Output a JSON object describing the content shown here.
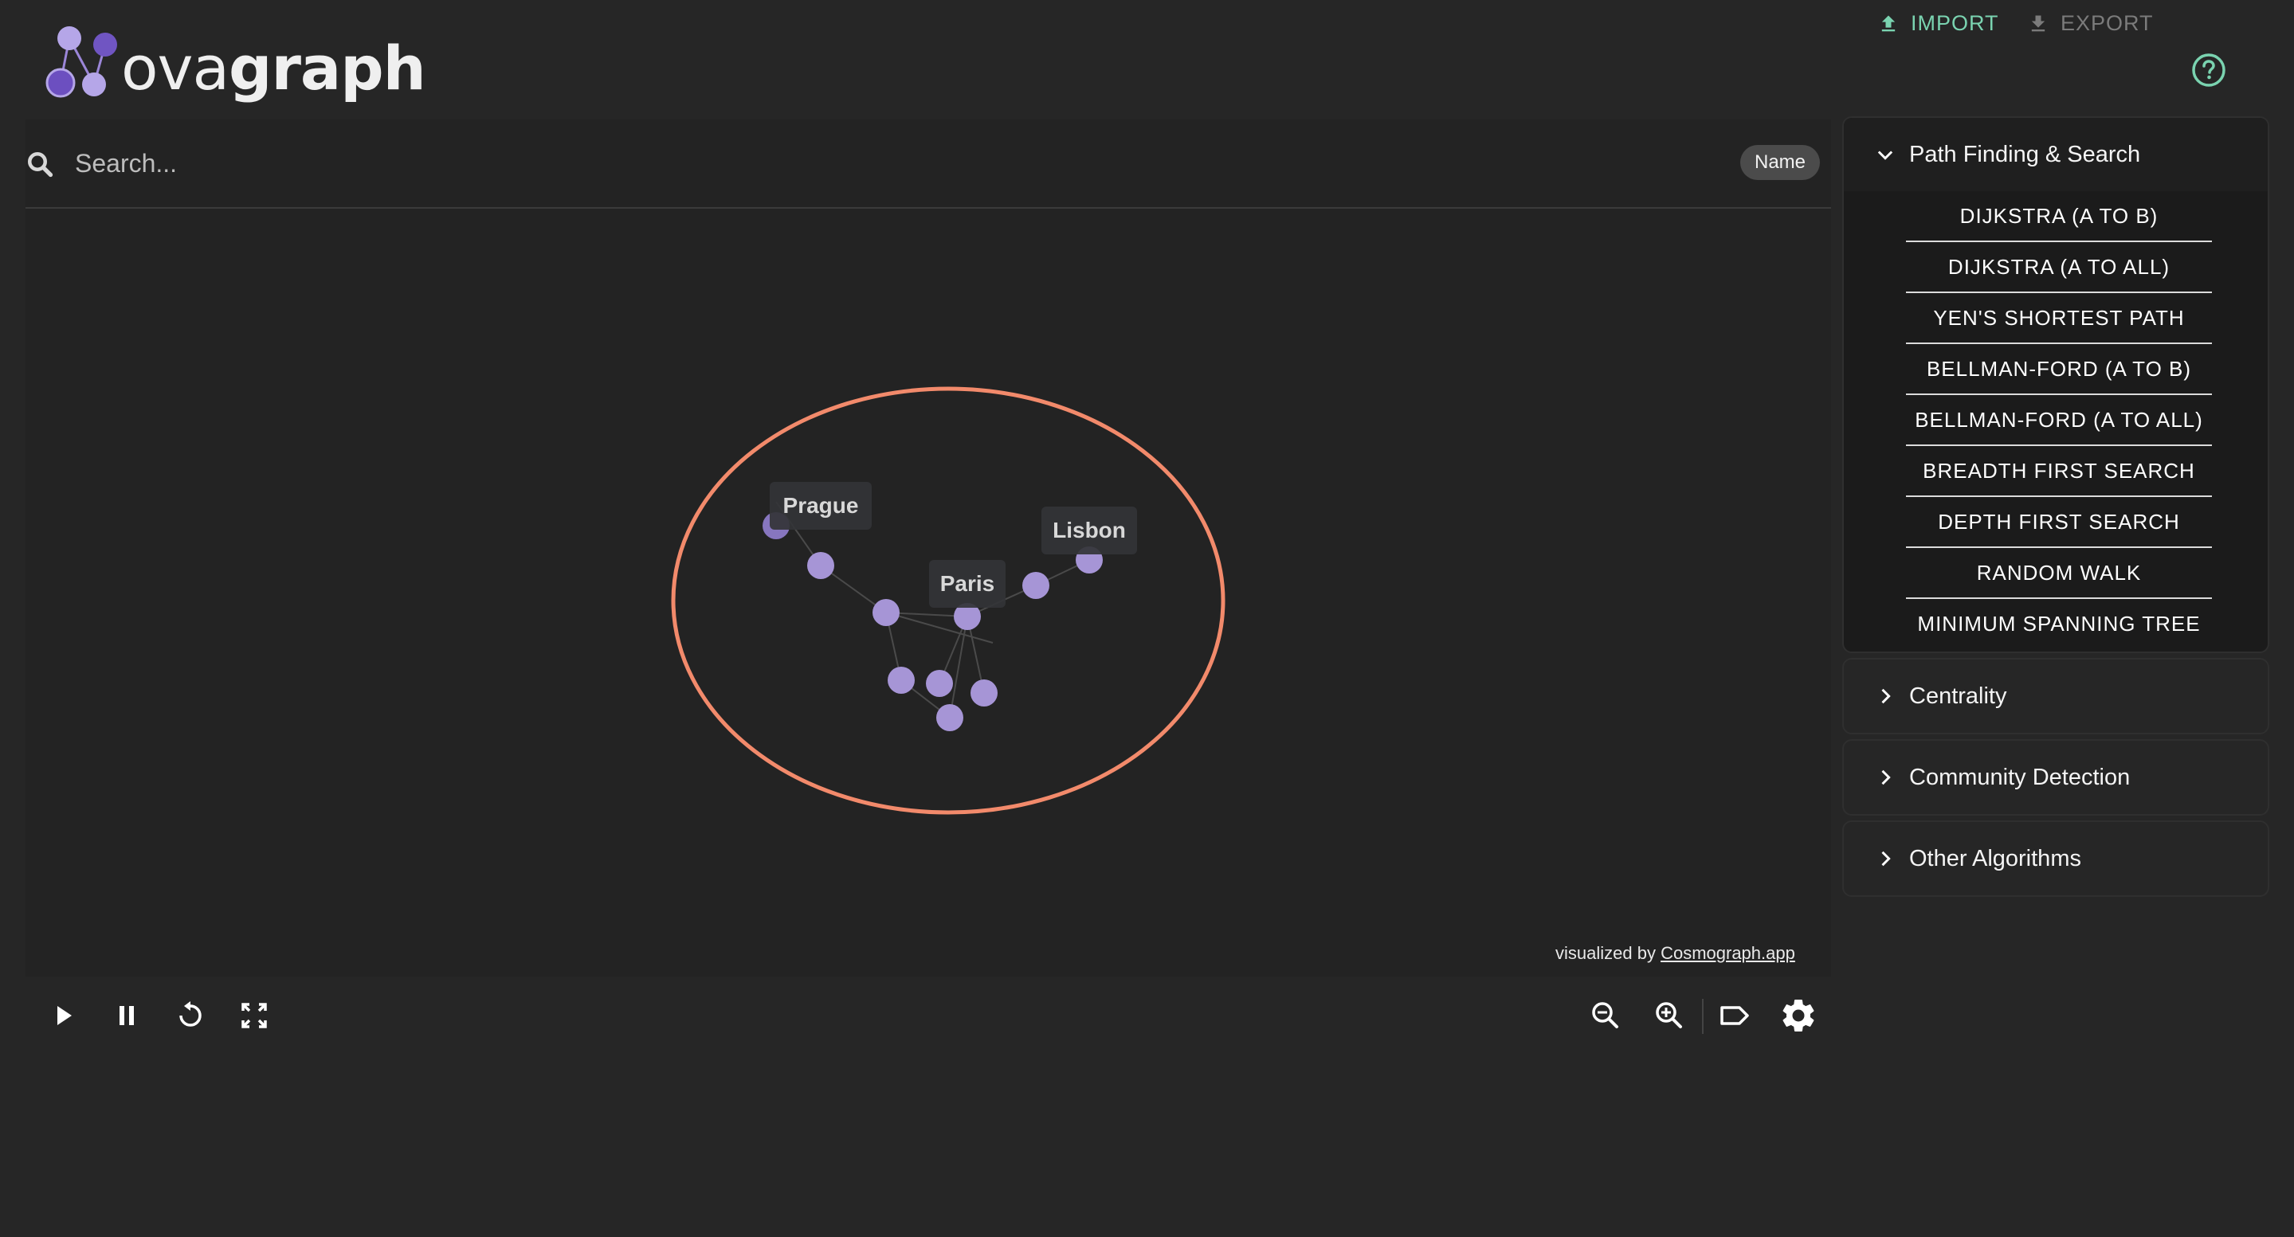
{
  "app": {
    "logo_plain": "ova",
    "logo_bold": "graph"
  },
  "header": {
    "import_label": "IMPORT",
    "export_label": "EXPORT"
  },
  "search": {
    "placeholder": "Search...",
    "field_chip": "Name"
  },
  "graph": {
    "labels": [
      "Prague",
      "Paris",
      "Lisbon"
    ],
    "node_color": "#a695d6",
    "highlight_color": "#f28a6b"
  },
  "credit": {
    "prefix": "visualized by ",
    "link": "Cosmograph.app"
  },
  "panel": {
    "sections": [
      {
        "title": "Path Finding & Search",
        "expanded": true,
        "items": [
          "DIJKSTRA (A TO B)",
          "DIJKSTRA (A TO ALL)",
          "YEN'S SHORTEST PATH",
          "BELLMAN-FORD (A TO B)",
          "BELLMAN-FORD (A TO ALL)",
          "BREADTH FIRST SEARCH",
          "DEPTH FIRST SEARCH",
          "RANDOM WALK",
          "MINIMUM SPANNING TREE"
        ]
      },
      {
        "title": "Centrality",
        "expanded": false
      },
      {
        "title": "Community Detection",
        "expanded": false
      },
      {
        "title": "Other Algorithms",
        "expanded": false
      }
    ]
  },
  "colors": {
    "accent": "#7ad3b0",
    "background": "#262626",
    "logo_purple": "#7b5cc7"
  }
}
